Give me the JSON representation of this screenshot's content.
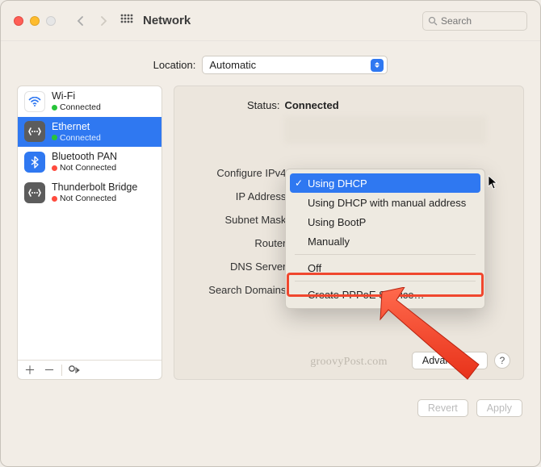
{
  "window": {
    "title": "Network",
    "search_placeholder": "Search"
  },
  "location": {
    "label": "Location:",
    "value": "Automatic"
  },
  "sidebar": {
    "services": [
      {
        "name": "Wi-Fi",
        "status": "Connected",
        "dot": "green",
        "icon": "wifi",
        "selected": false
      },
      {
        "name": "Ethernet",
        "status": "Connected",
        "dot": "green",
        "icon": "eth",
        "selected": true
      },
      {
        "name": "Bluetooth PAN",
        "status": "Not Connected",
        "dot": "red",
        "icon": "bt",
        "selected": false
      },
      {
        "name": "Thunderbolt Bridge",
        "status": "Not Connected",
        "dot": "red",
        "icon": "eth",
        "selected": false
      }
    ]
  },
  "main": {
    "status_label": "Status:",
    "status_value": "Connected",
    "fields": {
      "configure": "Configure IPv4:",
      "ip": "IP Address:",
      "subnet": "Subnet Mask:",
      "router": "Router:",
      "dns": "DNS Server:",
      "search_domains": "Search Domains:"
    },
    "advanced": "Advanced…"
  },
  "dropdown": {
    "options": [
      "Using DHCP",
      "Using DHCP with manual address",
      "Using BootP",
      "Manually",
      "Off",
      "Create PPPoE Service…"
    ],
    "selected_index": 0
  },
  "footer": {
    "revert": "Revert",
    "apply": "Apply"
  },
  "watermark": "groovyPost.com"
}
